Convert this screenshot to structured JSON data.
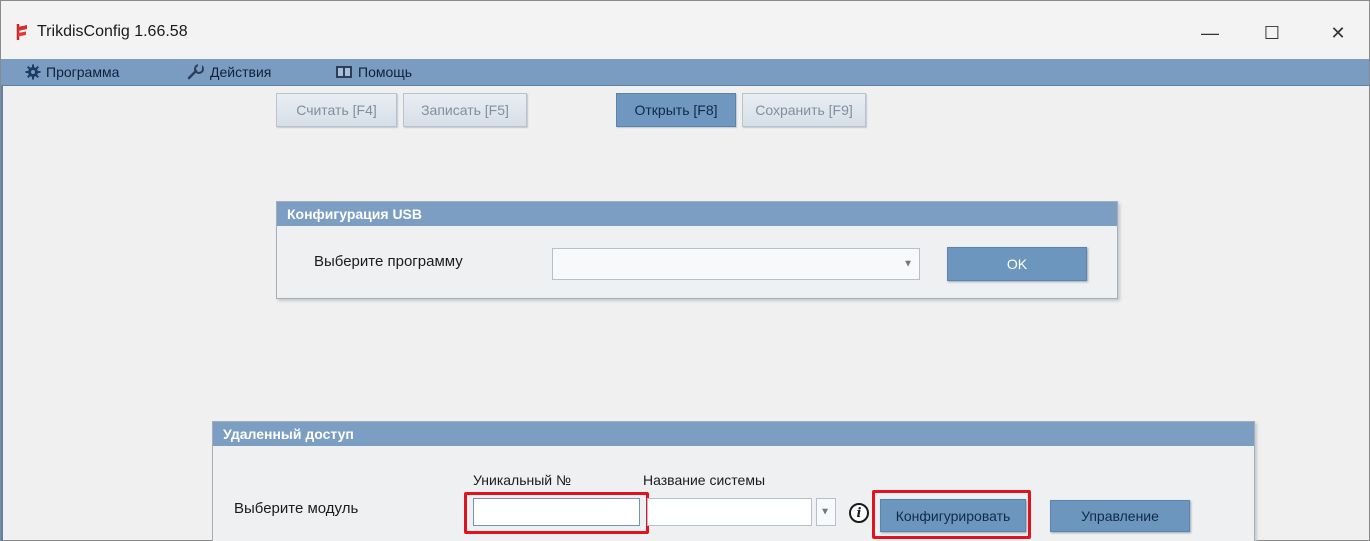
{
  "window": {
    "title": "TrikdisConfig 1.66.58",
    "controls": {
      "minimize": "—",
      "maximize": "☐",
      "close": "✕"
    }
  },
  "menu": {
    "items": [
      {
        "label": "Программа",
        "icon": "gear-icon"
      },
      {
        "label": "Действия",
        "icon": "wrench-icon"
      },
      {
        "label": "Помощь",
        "icon": "book-icon"
      }
    ]
  },
  "toolbar": {
    "read_label": "Считать [F4]",
    "write_label": "Записать [F5]",
    "open_label": "Открыть [F8]",
    "save_label": "Сохранить [F9]"
  },
  "usb_config": {
    "header": "Конфигурация USB",
    "select_program_label": "Выберите программу",
    "program_value": "",
    "ok_label": "OK"
  },
  "remote_access": {
    "header": "Удаленный доступ",
    "select_module_label": "Выберите модуль",
    "unique_no_label": "Уникальный №",
    "system_name_label": "Название системы",
    "unique_no_value": "",
    "system_name_value": "",
    "info_glyph": "i",
    "configure_label": "Конфигурировать",
    "manage_label": "Управление"
  },
  "colors": {
    "accent": "#7a9cc0",
    "button_blue": "#6d96be",
    "highlight_red": "#e0141e"
  }
}
